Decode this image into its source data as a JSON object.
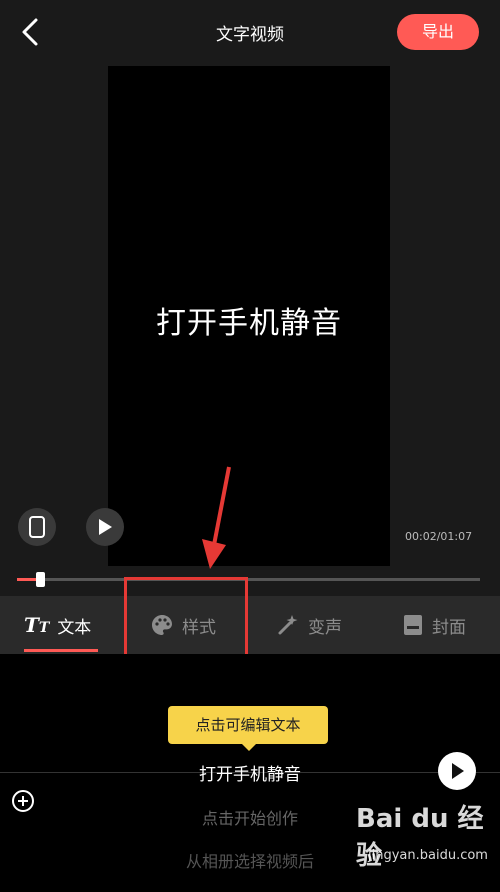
{
  "header": {
    "title": "文字视频",
    "export_label": "导出"
  },
  "preview": {
    "text": "打开手机静音",
    "time": "00:02/01:07",
    "progress": 0.05
  },
  "tabs": [
    {
      "label": "文本",
      "icon": "text-icon",
      "active": true
    },
    {
      "label": "样式",
      "icon": "palette-icon",
      "active": false
    },
    {
      "label": "变声",
      "icon": "magic-wand-icon",
      "active": false
    },
    {
      "label": "封面",
      "icon": "cover-icon",
      "active": false
    }
  ],
  "editor": {
    "tooltip": "点击可编辑文本",
    "current_line": "打开手机静音",
    "hint1": "点击开始创作",
    "hint2": "从相册选择视频后"
  },
  "watermark": {
    "brand": "Bai du 经验",
    "url": "jingyan.baidu.com"
  },
  "colors": {
    "accent": "#ff5a55",
    "tooltip": "#f7d34a",
    "highlight": "#e53935"
  }
}
